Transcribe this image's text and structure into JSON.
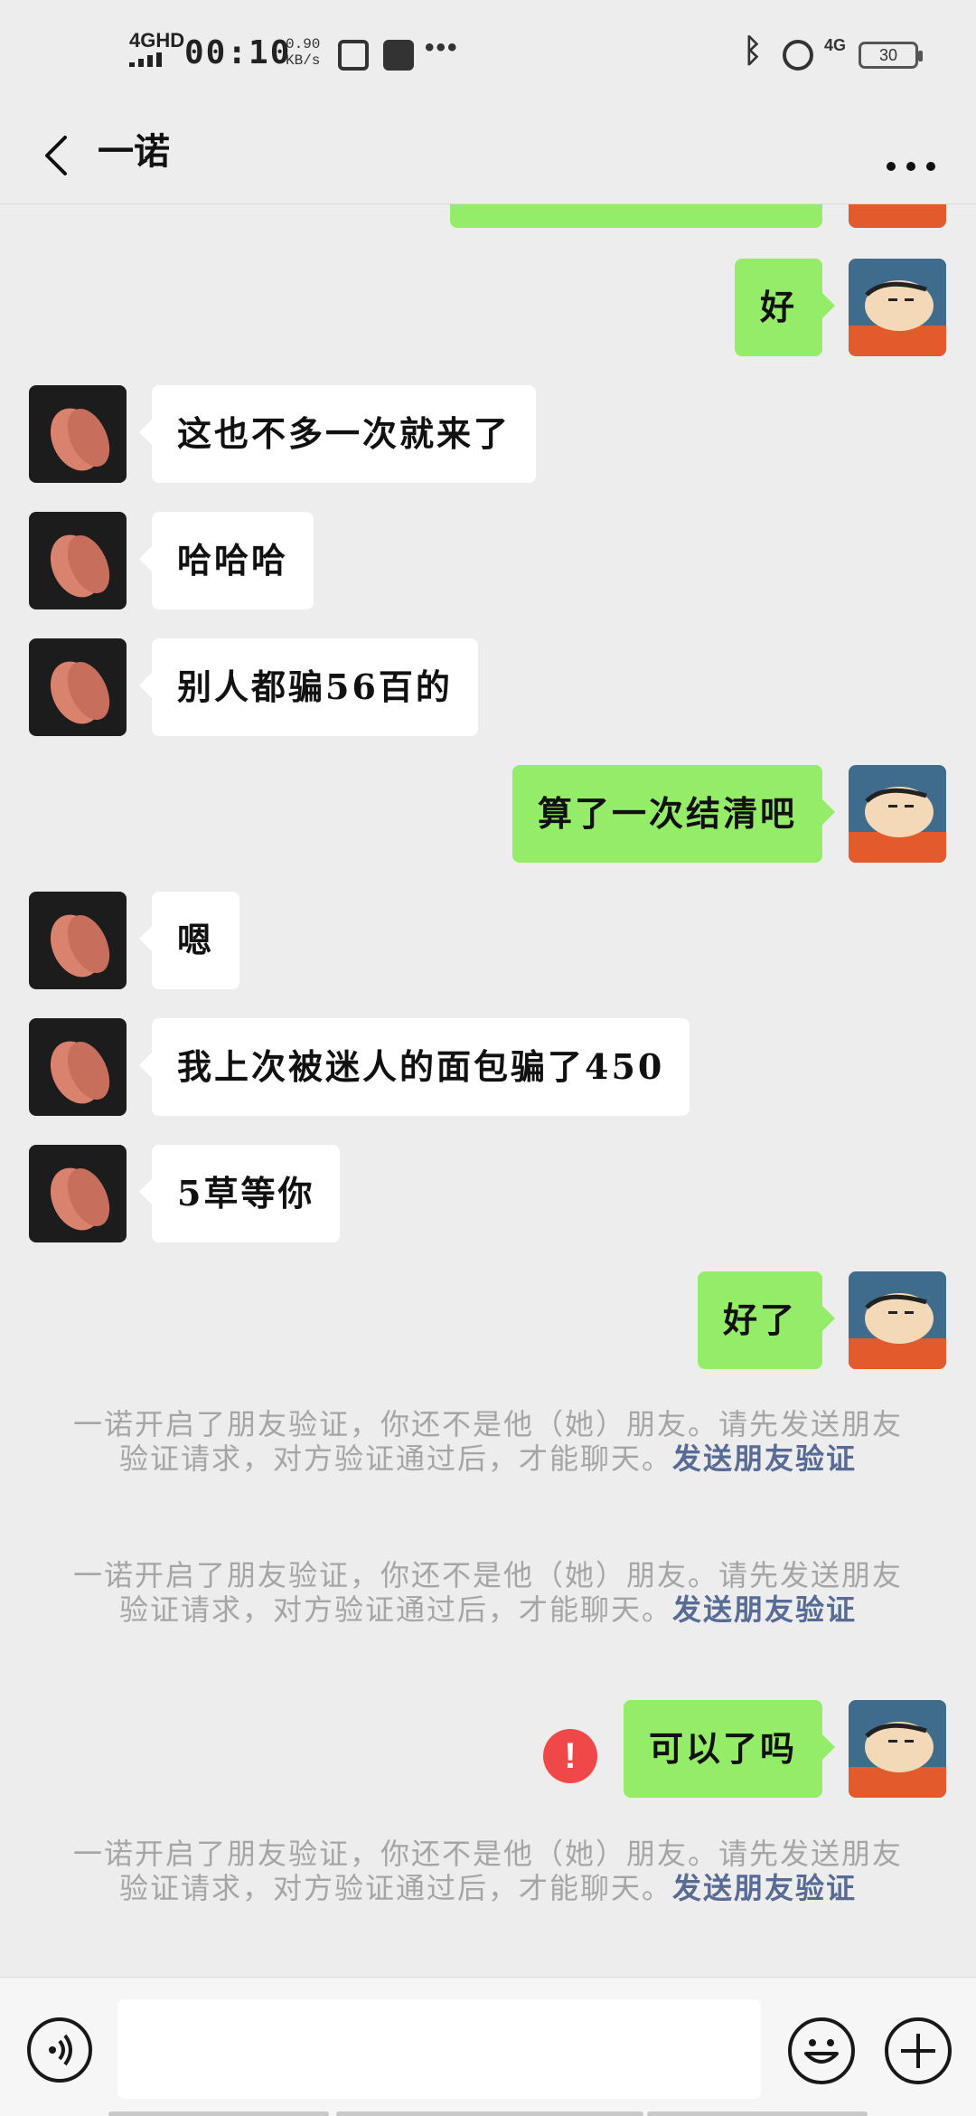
{
  "status_bar": {
    "network": "4GHD",
    "time": "00:10",
    "speed_value": "0.90",
    "speed_unit": "KB/s",
    "cellular": "4G",
    "battery": "30"
  },
  "header": {
    "title": "一诺"
  },
  "messages": [
    {
      "side": "right",
      "text": "好"
    },
    {
      "side": "left",
      "text": "这也不多一次就来了"
    },
    {
      "side": "left",
      "text": "哈哈哈"
    },
    {
      "side": "left",
      "text": "别人都骗56百的"
    },
    {
      "side": "right",
      "text": "算了一次结清吧"
    },
    {
      "side": "left",
      "text": "嗯"
    },
    {
      "side": "left",
      "text": "我上次被迷人的面包骗了450"
    },
    {
      "side": "left",
      "text": "5草等你"
    },
    {
      "side": "right",
      "text": "好了"
    },
    {
      "side": "right",
      "text": "可以了吗",
      "failed": true
    }
  ],
  "system_notice": {
    "text": "一诺开启了朋友验证，你还不是他（她）朋友。请先发送朋友验证请求，对方验证通过后，才能聊天。",
    "link": "发送朋友验证"
  },
  "failed_marker": "!",
  "input_bar": {
    "value": "",
    "placeholder": ""
  },
  "colors": {
    "background": "#ededed",
    "bubble_self": "#95ec69",
    "bubble_other": "#ffffff",
    "system_text": "#a5a5a5",
    "link": "#576b95",
    "fail_badge": "#f04848"
  }
}
